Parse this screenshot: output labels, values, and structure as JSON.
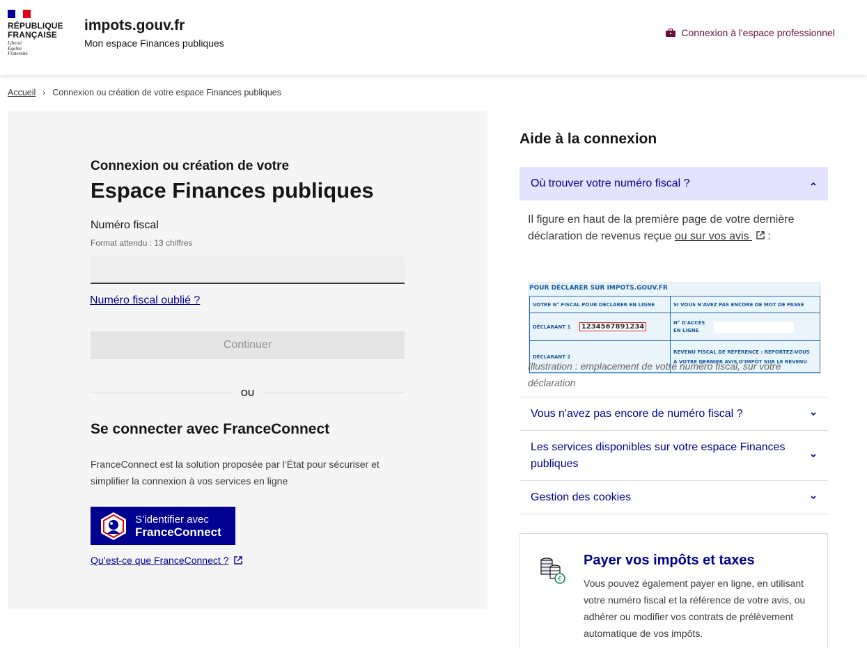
{
  "header": {
    "republic": [
      "RÉPUBLIQUE",
      "FRANÇAISE"
    ],
    "motto": [
      "Liberté",
      "Égalité",
      "Fraternité"
    ],
    "site_title": "impots.gouv.fr",
    "site_subtitle": "Mon espace Finances publiques",
    "pro_link": "Connexion à l'espace professionnel"
  },
  "breadcrumb": {
    "home": "Accueil",
    "current": "Connexion ou création de votre espace Finances publiques"
  },
  "login": {
    "pre_title": "Connexion ou création de votre",
    "title": "Espace Finances publiques",
    "field_label": "Numéro fiscal",
    "field_hint": "Format attendu : 13 chiffres",
    "field_value": "",
    "forgot_link": "Numéro fiscal oublié ?",
    "continue_button": "Continuer",
    "separator": "OU",
    "fc_title": "Se connecter avec FranceConnect",
    "fc_description": "FranceConnect est la solution proposée par l’État pour sécuriser et simplifier la connexion à vos services en ligne",
    "fc_button_line1": "S’identifier avec",
    "fc_button_line2": "FranceConnect",
    "fc_what_link": "Qu’est-ce que FranceConnect ?"
  },
  "help": {
    "title": "Aide à la connexion",
    "accordion_open": {
      "label": "Où trouver votre numéro fiscal ?",
      "body_text": "Il figure en haut de la première page de votre dernière déclaration de revenus reçue",
      "body_link": "ou sur vos avis",
      "body_end": " :",
      "illustration": {
        "header": "POUR DÉCLARER SUR IMPOTS.GOUV.FR",
        "col1_header": "VOTRE N° FISCAL POUR DÉCLARER EN LIGNE",
        "col2_header": "SI VOUS N'AVEZ PAS ENCORE DE MOT DE PASSE",
        "declarant1": "DÉCLARANT 1",
        "fiscal_number": "1234567891234",
        "access_label_1": "N° D'ACCÈS",
        "access_label_2": "EN LIGNE",
        "declarant2": "DÉCLARANT 2",
        "revenue_label_1": "REVENU FISCAL DE RÉFÉRENCE : REPORTEZ-VOUS",
        "revenue_label_2": "À VOTRE DERNIER AVIS D'IMPÔT SUR LE REVENU"
      },
      "caption": "Illustration : emplacement de votre numéro fiscal, sur votre déclaration"
    },
    "accordion_items": [
      "Vous n'avez pas encore de numéro fiscal ?",
      "Les services disponibles sur votre espace Finances publiques",
      "Gestion des cookies"
    ]
  },
  "pay_card": {
    "title": "Payer vos impôts et taxes",
    "description": "Vous pouvez également payer en ligne, en utilisant votre numéro fiscal et la référence de votre avis, ou adhérer ou modifier vos contrats de prélèvement automatique de vos impôts."
  },
  "colors": {
    "primary": "#000091",
    "pro_link": "#6a0f3c",
    "accordion_active_bg": "#e3e3fd",
    "panel_bg": "#f5f5f5"
  }
}
